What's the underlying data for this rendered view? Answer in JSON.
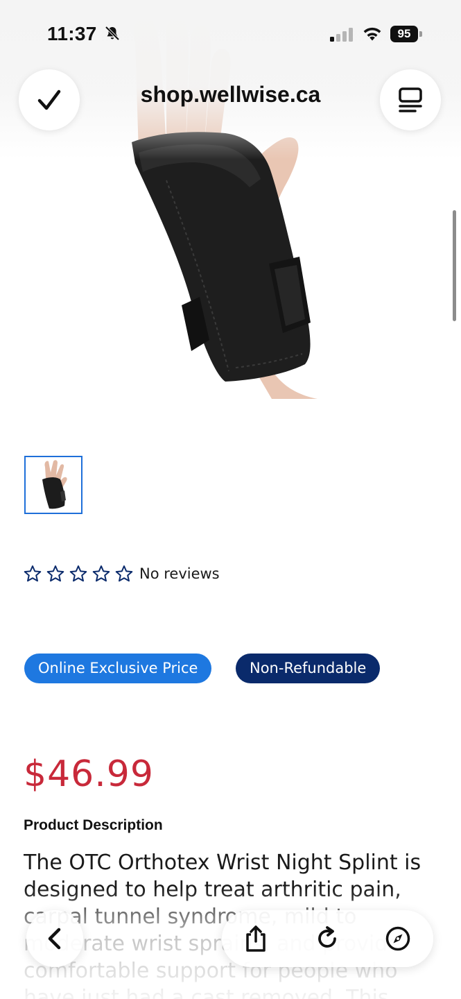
{
  "status_bar": {
    "time": "11:37",
    "battery": "95"
  },
  "browser": {
    "url": "shop.wellwise.ca",
    "icons": {
      "done": "checkmark-icon",
      "tabs": "tabs-icon",
      "back": "back-chevron-icon",
      "share": "share-icon",
      "reload": "reload-icon",
      "compass": "compass-icon"
    }
  },
  "product": {
    "rating_text": "No reviews",
    "stars_filled": 0,
    "stars_total": 5,
    "badges": [
      "Online Exclusive Price",
      "Non-Refundable"
    ],
    "price": "$46.99",
    "description_title": "Product Description",
    "description": "The OTC Orthotex Wrist Night Splint is designed to help treat arthritic pain, carpal tunnel syndrome, mild to moderate wrist sprains, and provide comfortable support for people who have just had a cast removed. This"
  },
  "colors": {
    "price": "#c8293a",
    "badge_online": "#1e78e0",
    "badge_nonrefundable": "#0a2a6b",
    "thumbnail_border": "#1e6fd9",
    "star_outline": "#0a2a6b"
  }
}
